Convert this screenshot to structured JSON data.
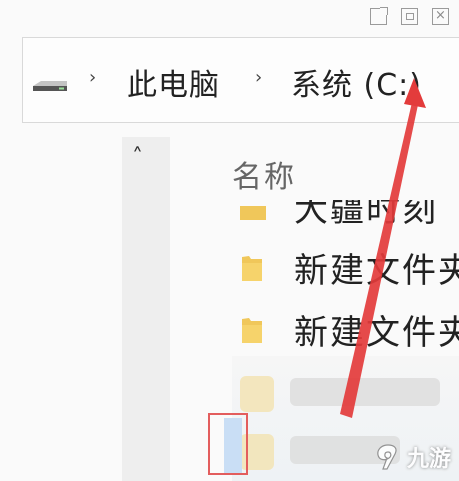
{
  "window": {
    "controls": [
      "popout",
      "restore",
      "close"
    ],
    "close_glyph": "×"
  },
  "address_bar": {
    "icon": "drive-icon",
    "separator": "›",
    "breadcrumb": [
      "此电脑",
      "系统 (C:)"
    ]
  },
  "nav_pane": {
    "scroll_up_glyph": "˄"
  },
  "file_list": {
    "column_header": "名称",
    "items": [
      {
        "name": "大疆时刻",
        "icon": "folder-icon"
      },
      {
        "name": "新建文件夹",
        "icon": "folder-icon"
      },
      {
        "name": "新建文件夹",
        "icon": "folder-icon"
      }
    ]
  },
  "colors": {
    "annotation_arrow": "#e33b3b",
    "folder": "#f0c75a",
    "highlight_box": "#e35d5d"
  },
  "watermark": {
    "text": "九游",
    "logo": "9-swirl-logo"
  }
}
